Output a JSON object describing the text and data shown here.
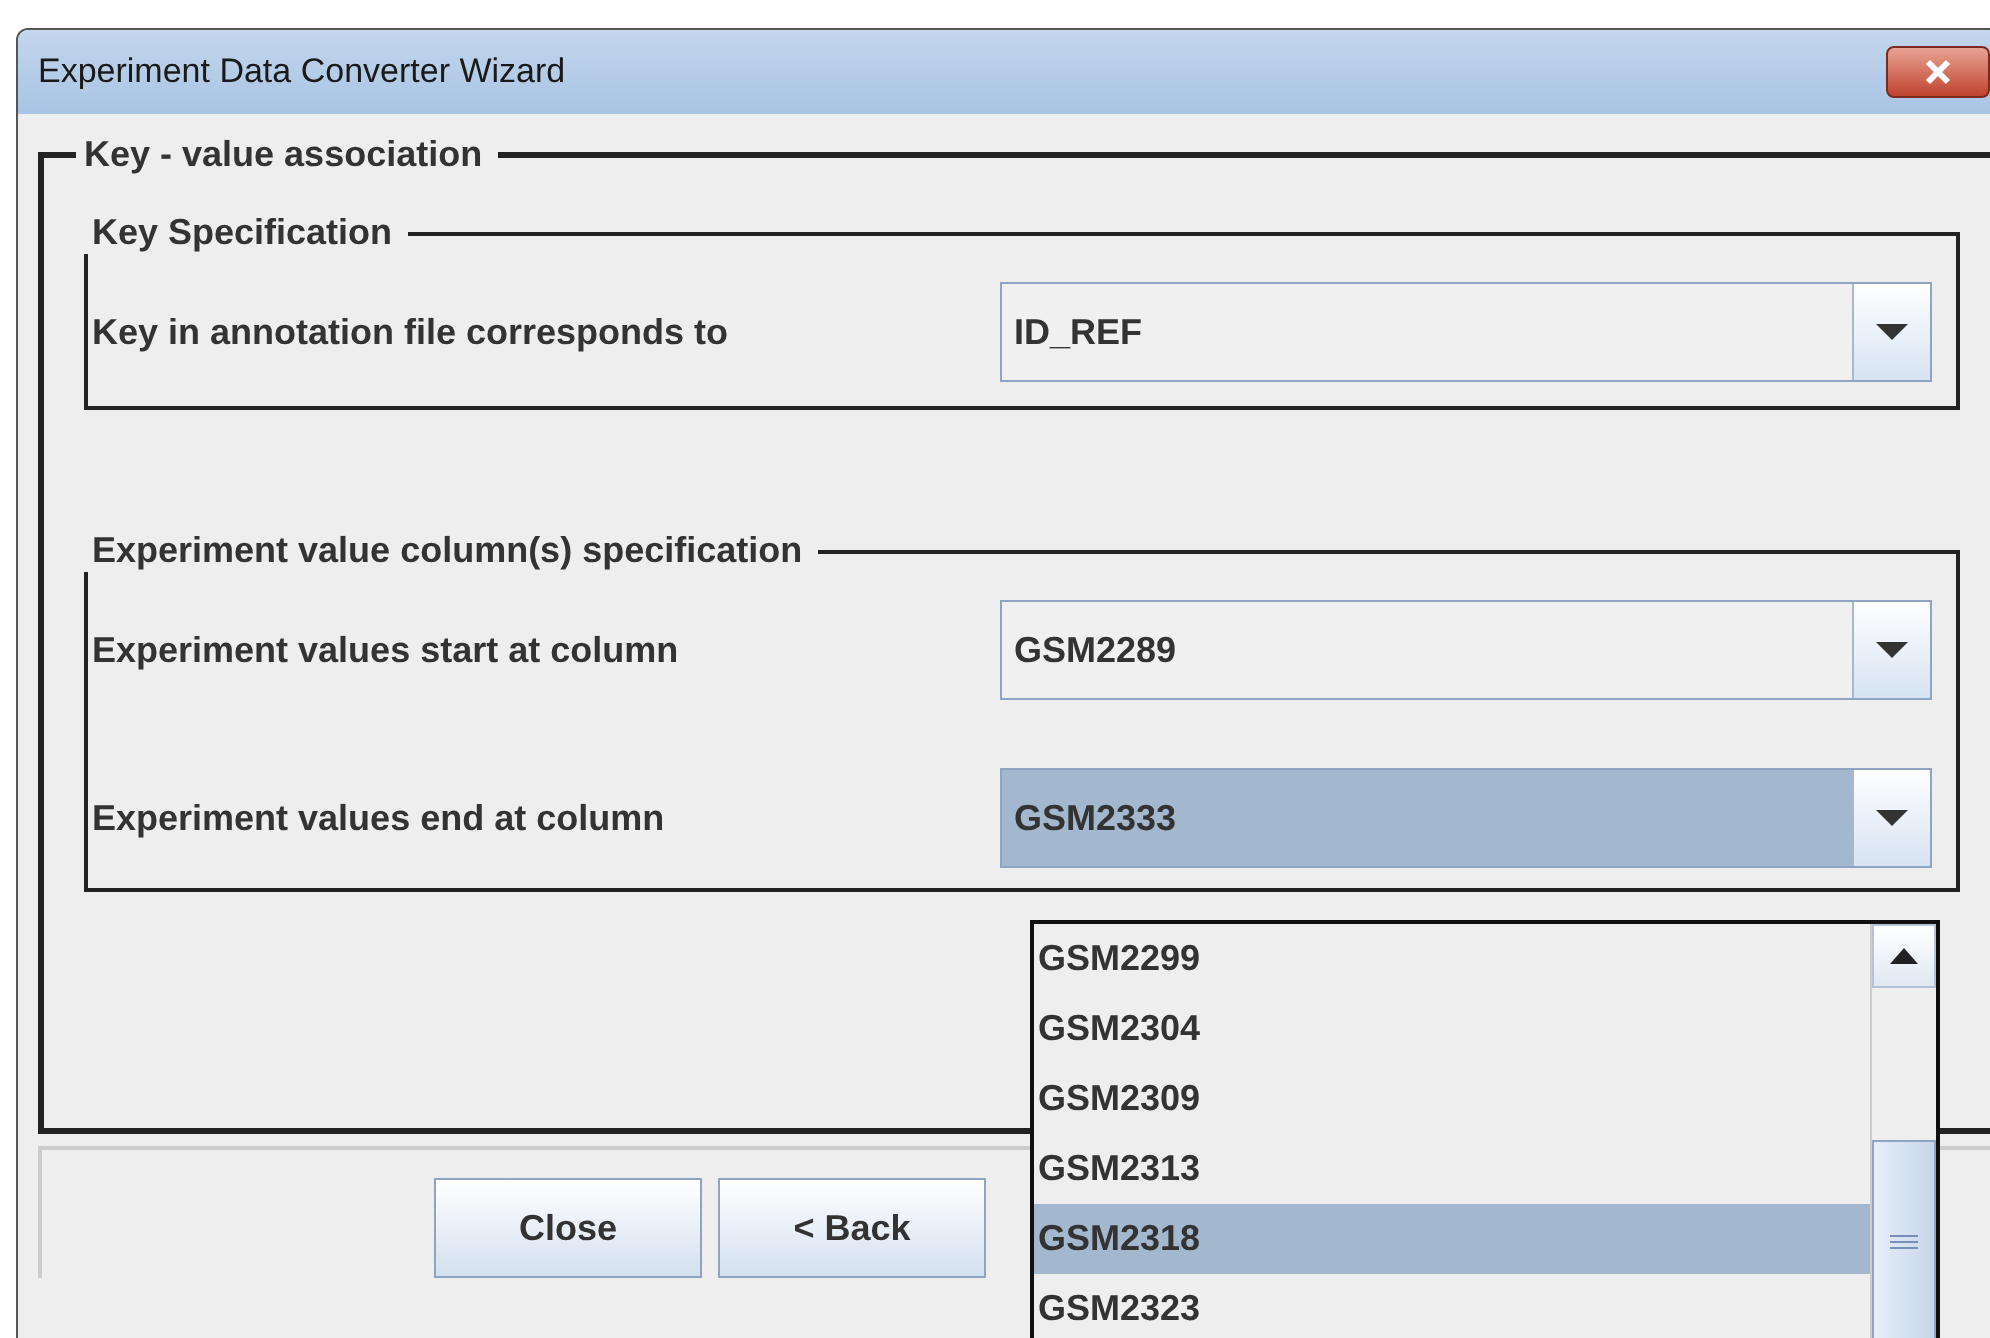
{
  "window": {
    "title": "Experiment Data Converter Wizard"
  },
  "group": {
    "title": "Key - value association",
    "sections": [
      {
        "title": "Key Specification",
        "rows": [
          {
            "label": "Key in annotation file corresponds to",
            "value": "ID_REF",
            "selected": false
          }
        ]
      },
      {
        "title": "Experiment value column(s) specification",
        "rows": [
          {
            "label": "Experiment values start at column",
            "value": "GSM2289",
            "selected": false
          },
          {
            "label": "Experiment values  end  at column",
            "value": "GSM2333",
            "selected": true
          }
        ]
      }
    ]
  },
  "dropdown": {
    "items": [
      {
        "label": "GSM2299",
        "selected": false
      },
      {
        "label": "GSM2304",
        "selected": false
      },
      {
        "label": "GSM2309",
        "selected": false
      },
      {
        "label": "GSM2313",
        "selected": false
      },
      {
        "label": "GSM2318",
        "selected": true
      },
      {
        "label": "GSM2323",
        "selected": false
      }
    ]
  },
  "buttons": [
    "Close",
    "< Back"
  ]
}
